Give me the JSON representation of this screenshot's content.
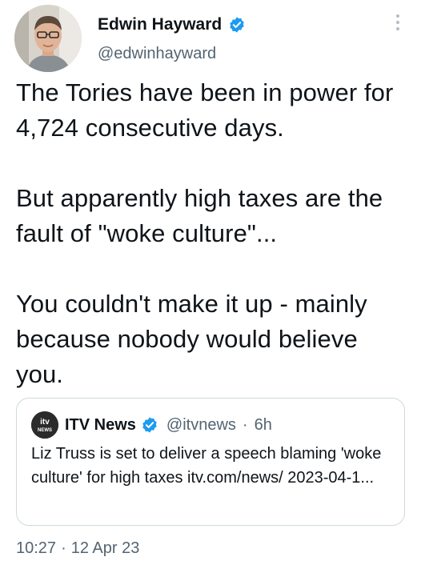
{
  "author": {
    "display_name": "Edwin Hayward",
    "handle": "@edwinhayward",
    "avatar_icon": "person-photo-avatar",
    "verified_icon": "verified-badge-icon"
  },
  "tweet": {
    "paragraphs": [
      "The Tories have been in power for 4,724 consecutive days.",
      "But apparently high taxes are the fault of \"woke culture\"...",
      "You couldn't make it up - mainly because nobody would believe you."
    ],
    "time": "10:27",
    "separator": "·",
    "date": "12 Apr 23"
  },
  "quoted_tweet": {
    "logo_text": "itv NEWS",
    "display_name": "ITV News",
    "handle": "@itvnews",
    "separator": "·",
    "age": "6h",
    "text": "Liz Truss is set to deliver a speech blaming 'woke culture' for high taxes  itv.com/news/ 2023-04-1..."
  },
  "colors": {
    "text": "#0f1419",
    "muted": "#536471",
    "verified": "#1d9bf0",
    "border": "#cfd9de"
  }
}
